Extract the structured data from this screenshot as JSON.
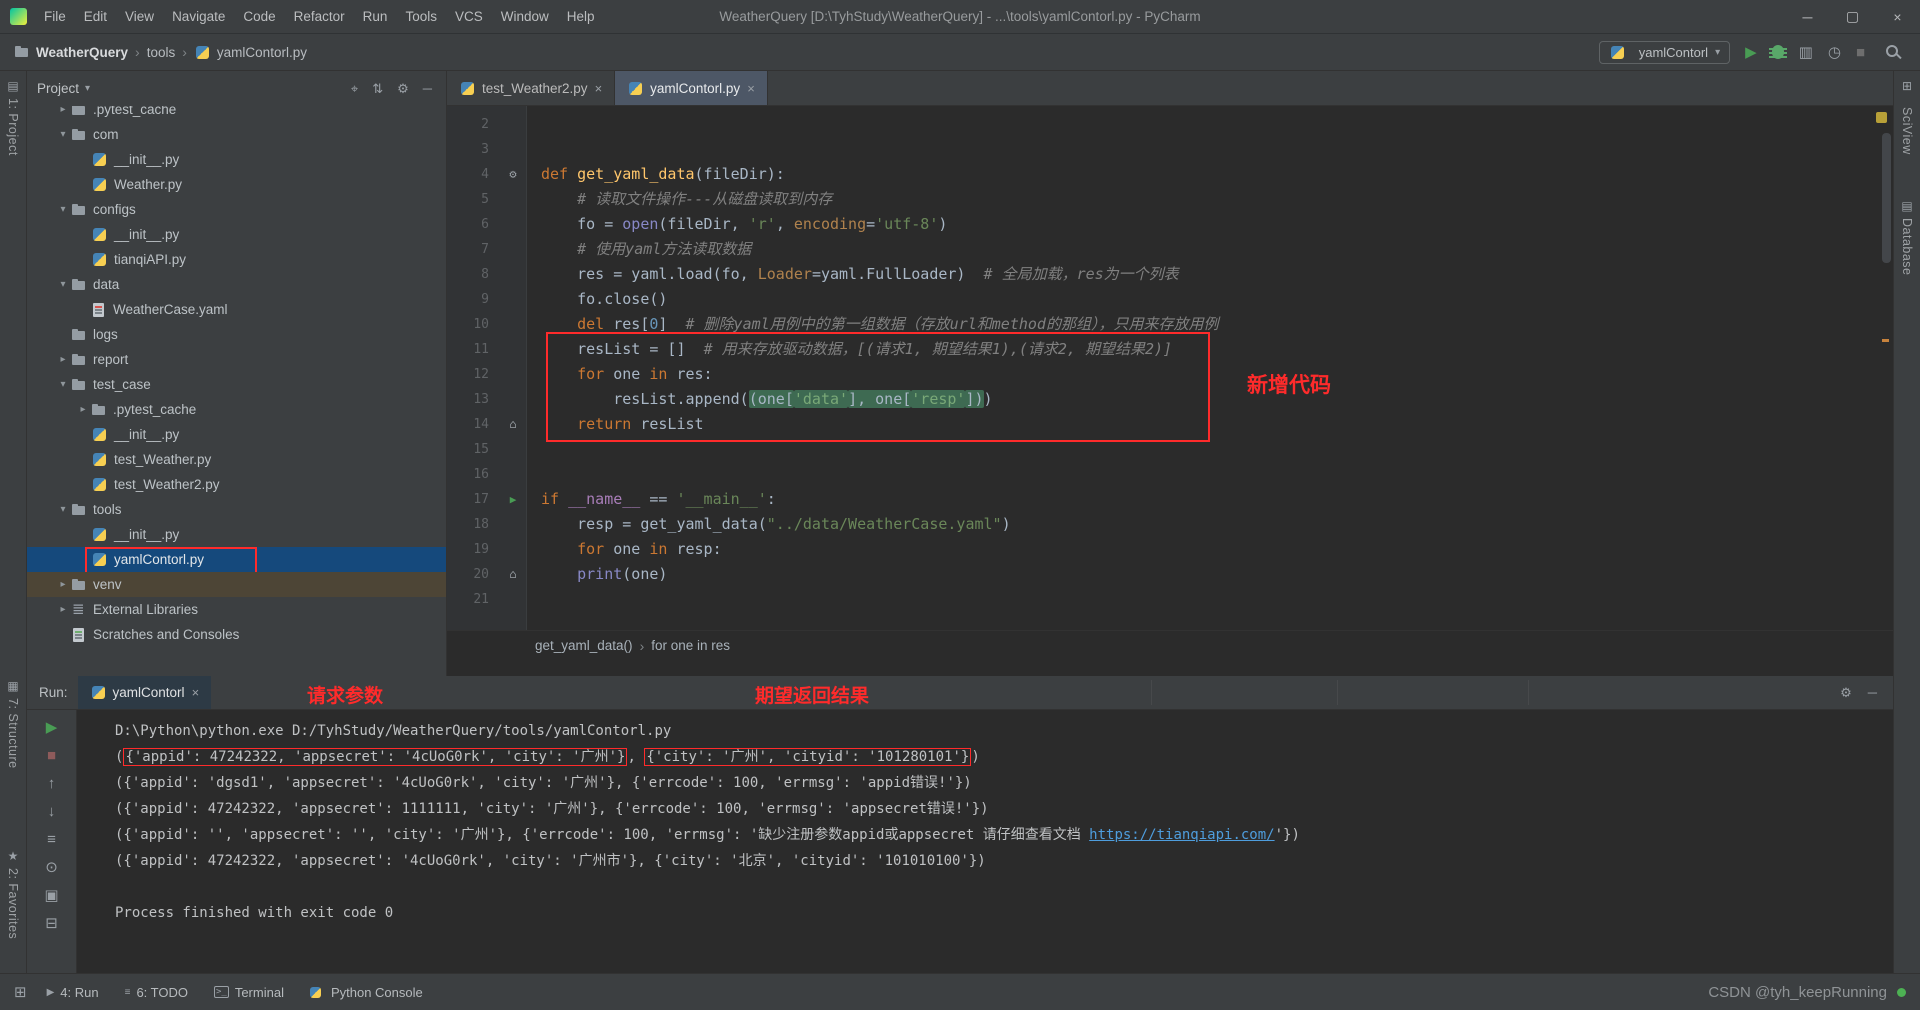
{
  "titlebar": {
    "menus": [
      "File",
      "Edit",
      "View",
      "Navigate",
      "Code",
      "Refactor",
      "Run",
      "Tools",
      "VCS",
      "Window",
      "Help"
    ],
    "title": "WeatherQuery [D:\\TyhStudy\\WeatherQuery] - ...\\tools\\yamlContorl.py - PyCharm",
    "window_controls": {
      "minimize": "─",
      "maximize": "▢",
      "close": "×"
    }
  },
  "navbar": {
    "breadcrumb": [
      {
        "label": "WeatherQuery",
        "icon": "folder",
        "bold": true
      },
      {
        "label": "tools"
      },
      {
        "label": "yamlContorl.py",
        "icon": "py"
      }
    ],
    "run_config": {
      "label": "yamlContorl",
      "caret": "▾"
    },
    "actions": [
      {
        "name": "run-icon",
        "glyph": "▶",
        "color": "#499C54"
      },
      {
        "name": "debug-icon",
        "glyph": "bug",
        "color": "#59A869"
      },
      {
        "name": "coverage-icon",
        "glyph": "▥",
        "color": "#9AA0A6"
      },
      {
        "name": "profiler-icon",
        "glyph": "◷",
        "color": "#9AA0A6"
      },
      {
        "name": "stop-icon",
        "glyph": "■",
        "color": "#6E6E6E"
      }
    ]
  },
  "project_panel": {
    "title": "Project",
    "caret": "▾",
    "header_icons": [
      {
        "name": "locate-file-icon",
        "glyph": "⌖"
      },
      {
        "name": "collapse-all-icon",
        "glyph": "⇅"
      },
      {
        "name": "settings-icon",
        "glyph": "⚙"
      },
      {
        "name": "hide-panel-icon",
        "glyph": "─"
      }
    ],
    "tree": [
      {
        "label": ".pytest_cache",
        "indent": 1,
        "icon": "folder",
        "chev": "closed",
        "cls": "clip"
      },
      {
        "label": "com",
        "indent": 1,
        "icon": "folder",
        "chev": "open"
      },
      {
        "label": "__init__.py",
        "indent": 2,
        "icon": "py"
      },
      {
        "label": "Weather.py",
        "indent": 2,
        "icon": "py"
      },
      {
        "label": "configs",
        "indent": 1,
        "icon": "folder",
        "chev": "open"
      },
      {
        "label": "__init__.py",
        "indent": 2,
        "icon": "py"
      },
      {
        "label": "tianqiAPI.py",
        "indent": 2,
        "icon": "py"
      },
      {
        "label": "data",
        "indent": 1,
        "icon": "folder",
        "chev": "open"
      },
      {
        "label": "WeatherCase.yaml",
        "indent": 2,
        "icon": "yaml"
      },
      {
        "label": "logs",
        "indent": 1,
        "icon": "folder"
      },
      {
        "label": "report",
        "indent": 1,
        "icon": "folder",
        "chev": "closed"
      },
      {
        "label": "test_case",
        "indent": 1,
        "icon": "folder",
        "chev": "open"
      },
      {
        "label": ".pytest_cache",
        "indent": 2,
        "icon": "folder",
        "chev": "closed"
      },
      {
        "label": "__init__.py",
        "indent": 2,
        "icon": "py"
      },
      {
        "label": "test_Weather.py",
        "indent": 2,
        "icon": "py"
      },
      {
        "label": "test_Weather2.py",
        "indent": 2,
        "icon": "py"
      },
      {
        "label": "tools",
        "indent": 1,
        "icon": "folder",
        "chev": "open"
      },
      {
        "label": "__init__.py",
        "indent": 2,
        "icon": "py"
      },
      {
        "label": "yamlContorl.py",
        "indent": 2,
        "icon": "py",
        "sel": true,
        "red": true
      },
      {
        "label": "venv",
        "indent": 1,
        "icon": "folder",
        "chev": "closed",
        "cls": "venv"
      },
      {
        "label": "External Libraries",
        "indent": 1,
        "icon": "lib",
        "chev": "closed"
      },
      {
        "label": "Scratches and Consoles",
        "indent": 1,
        "icon": "scratch"
      }
    ]
  },
  "editor": {
    "tabs": [
      {
        "label": "test_Weather2.py",
        "icon": "py",
        "close": "×"
      },
      {
        "label": "yamlContorl.py",
        "icon": "py",
        "close": "×",
        "active": true
      }
    ],
    "note": "新增代码",
    "breadcrumb": [
      "get_yaml_data()",
      "for one in res"
    ],
    "lines": [
      {
        "n": 2,
        "seg": []
      },
      {
        "n": 3,
        "seg": []
      },
      {
        "n": 4,
        "icon": "gear",
        "seg": [
          [
            "kw",
            "def "
          ],
          [
            "fn",
            "get_yaml_data"
          ],
          [
            "d",
            "(fileDir):"
          ]
        ]
      },
      {
        "n": 5,
        "seg": [
          [
            "d",
            "    "
          ],
          [
            "cm",
            "# 读取文件操作---从磁盘读取到内存"
          ]
        ]
      },
      {
        "n": 6,
        "seg": [
          [
            "d",
            "    fo = "
          ],
          [
            "bi",
            "open"
          ],
          [
            "d",
            "(fileDir, "
          ],
          [
            "st",
            "'r'"
          ],
          [
            "d",
            ", "
          ],
          [
            "ka",
            "encoding"
          ],
          [
            "d",
            "="
          ],
          [
            "st",
            "'utf-8'"
          ],
          [
            "d",
            ")"
          ]
        ]
      },
      {
        "n": 7,
        "seg": [
          [
            "d",
            "    "
          ],
          [
            "cm",
            "# 使用yaml方法读取数据"
          ]
        ]
      },
      {
        "n": 8,
        "seg": [
          [
            "d",
            "    res = yaml.load(fo, "
          ],
          [
            "ka",
            "Loader"
          ],
          [
            "d",
            "=yaml.FullLoader)  "
          ],
          [
            "cm",
            "# 全局加载，res为一个列表"
          ]
        ]
      },
      {
        "n": 9,
        "seg": [
          [
            "d",
            "    fo.close()"
          ]
        ]
      },
      {
        "n": 10,
        "seg": [
          [
            "d",
            "    "
          ],
          [
            "kw",
            "del "
          ],
          [
            "d",
            "res["
          ],
          [
            "nu",
            "0"
          ],
          [
            "d",
            "]  "
          ],
          [
            "cm",
            "# 删除yaml用例中的第一组数据（存放url和method的那组），只用来存放用例"
          ]
        ]
      },
      {
        "n": 11,
        "seg": [
          [
            "d",
            "    resList = []  "
          ],
          [
            "cm",
            "# 用来存放驱动数据，[(请求1, 期望结果1),(请求2, 期望结果2)]"
          ]
        ]
      },
      {
        "n": 12,
        "seg": [
          [
            "d",
            "    "
          ],
          [
            "kw",
            "for "
          ],
          [
            "d",
            "one "
          ],
          [
            "kw",
            "in "
          ],
          [
            "d",
            "res:"
          ]
        ]
      },
      {
        "n": 13,
        "seg": [
          [
            "d",
            "        resList.append("
          ],
          [
            "hl",
            "(one["
          ],
          [
            "sthl",
            "'data'"
          ],
          [
            "hl",
            "], one["
          ],
          [
            "sthl",
            "'resp'"
          ],
          [
            "hl",
            "])"
          ],
          [
            "d",
            ")"
          ]
        ]
      },
      {
        "n": 14,
        "icon": "home",
        "seg": [
          [
            "d",
            "    "
          ],
          [
            "kw",
            "return "
          ],
          [
            "d",
            "resList"
          ]
        ]
      },
      {
        "n": 15,
        "seg": []
      },
      {
        "n": 16,
        "seg": []
      },
      {
        "n": 17,
        "icon": "run",
        "seg": [
          [
            "kw",
            "if "
          ],
          [
            "du",
            "__name__"
          ],
          [
            "d",
            " == "
          ],
          [
            "st",
            "'__main__'"
          ],
          [
            "d",
            ":"
          ]
        ]
      },
      {
        "n": 18,
        "seg": [
          [
            "d",
            "    resp = get_yaml_data("
          ],
          [
            "st",
            "\"../data/WeatherCase.yaml\""
          ],
          [
            "d",
            ")"
          ]
        ]
      },
      {
        "n": 19,
        "seg": [
          [
            "d",
            "    "
          ],
          [
            "kw",
            "for "
          ],
          [
            "d",
            "one "
          ],
          [
            "kw",
            "in "
          ],
          [
            "d",
            "resp:"
          ]
        ]
      },
      {
        "n": 20,
        "icon": "home",
        "seg": [
          [
            "d",
            "    "
          ],
          [
            "bi",
            "print"
          ],
          [
            "d",
            "(one)"
          ]
        ]
      },
      {
        "n": 21,
        "seg": []
      }
    ]
  },
  "run_panel": {
    "label": "Run:",
    "tab": {
      "label": "yamlContorl",
      "close": "×"
    },
    "note_request": "请求参数",
    "note_expected": "期望返回结果",
    "header_icons": [
      {
        "name": "settings-icon",
        "glyph": "⚙"
      },
      {
        "name": "hide-panel-icon",
        "glyph": "─"
      }
    ],
    "toolbar": [
      {
        "name": "rerun-icon",
        "glyph": "▶",
        "color": "#499C54"
      },
      {
        "name": "stop-icon",
        "glyph": "■",
        "color": "#8E5B5B"
      },
      {
        "name": "scroll-up-icon",
        "glyph": "↑",
        "color": "#9AA0A6"
      },
      {
        "name": "scroll-down-icon",
        "glyph": "↓",
        "color": "#9AA0A6"
      },
      {
        "name": "restore-layout-icon",
        "glyph": "≡",
        "color": "#9AA0A6"
      },
      {
        "name": "pin-tab-icon",
        "glyph": "⊙",
        "color": "#9AA0A6"
      },
      {
        "name": "print-icon",
        "glyph": "▣",
        "color": "#9AA0A6"
      },
      {
        "name": "clear-all-icon",
        "glyph": "⊟",
        "color": "#9AA0A6"
      }
    ],
    "console": [
      [
        [
          "",
          "D:\\Python\\python.exe D:/TyhStudy/WeatherQuery/tools/yamlContorl.py"
        ]
      ],
      [
        [
          "",
          "("
        ],
        [
          "box",
          "{'appid': 47242322, 'appsecret': '4cUoG0rk', 'city': '广州'}"
        ],
        [
          "",
          ", "
        ],
        [
          "box",
          "{'city': '广州', 'cityid': '101280101'}"
        ],
        [
          "",
          ")"
        ]
      ],
      [
        [
          "",
          "({'appid': 'dgsd1', 'appsecret': '4cUoG0rk', 'city': '广州'}, {'errcode': 100, 'errmsg': 'appid错误!'})"
        ]
      ],
      [
        [
          "",
          "({'appid': 47242322, 'appsecret': 1111111, 'city': '广州'}, {'errcode': 100, 'errmsg': 'appsecret错误!'})"
        ]
      ],
      [
        [
          "",
          "({'appid': '', 'appsecret': '', 'city': '广州'}, {'errcode': 100, 'errmsg': '缺少注册参数appid或appsecret 请仔细查看文档 "
        ],
        [
          "link",
          "https://tianqiapi.com/"
        ],
        [
          "",
          "'})"
        ]
      ],
      [
        [
          "",
          "({'appid': 47242322, 'appsecret': '4cUoG0rk', 'city': '广州市'}, {'city': '北京', 'cityid': '101010100'})"
        ]
      ],
      [],
      [
        [
          "",
          "Process finished with exit code 0"
        ]
      ]
    ]
  },
  "statusbar": {
    "switcher": "⊞",
    "items": [
      {
        "icon": "run",
        "label": "4: Run"
      },
      {
        "icon": "todo",
        "label": "6: TODO"
      },
      {
        "icon": "terminal",
        "label": "Terminal"
      },
      {
        "icon": "py",
        "label": "Python Console"
      }
    ],
    "watermark": "CSDN @tyh_keepRunning"
  },
  "stripes": {
    "left_top": "1: Project",
    "left_structure": "7: Structure",
    "left_favorites": "2: Favorites",
    "left_project_icon": "▤",
    "left_structure_icon": "▦",
    "left_favorites_icon": "★",
    "right_grid_icon": "⊞",
    "right_db_icon": "▤",
    "right_sciview": "SciView",
    "right_database": "Database"
  }
}
